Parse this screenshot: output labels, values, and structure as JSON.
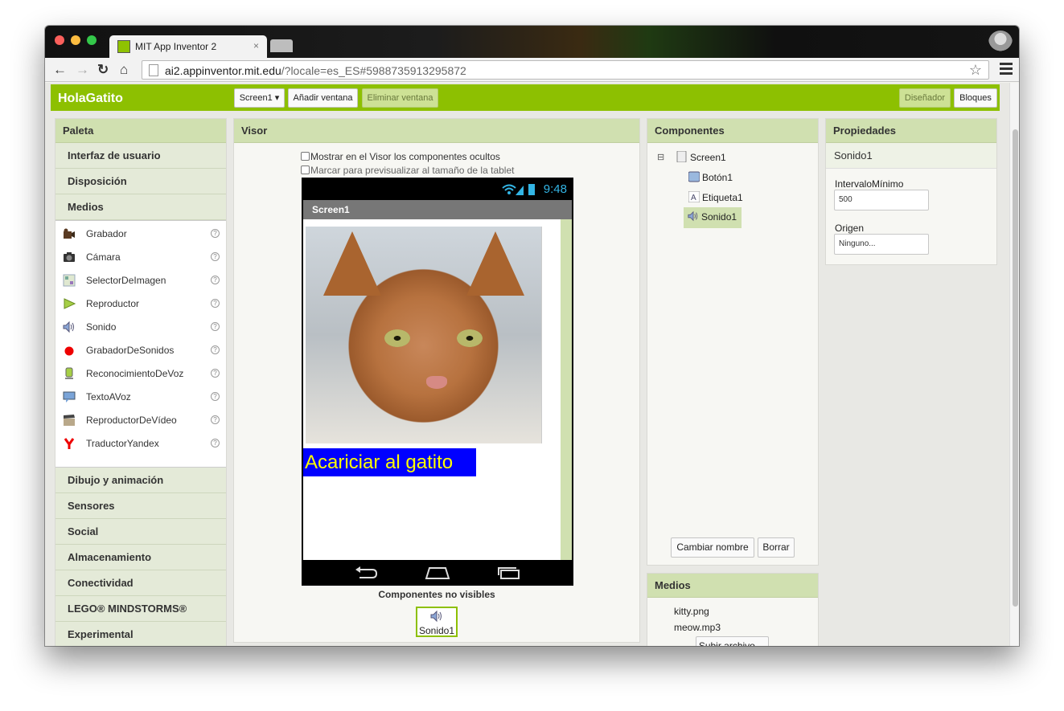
{
  "browser": {
    "tab_title": "MIT App Inventor 2",
    "tab_close": "×",
    "url_host": "ai2.appinventor.mit.edu",
    "url_path": "/?locale=es_ES#5988735913295872"
  },
  "appbar": {
    "project_name": "HolaGatito",
    "screen_select": "Screen1 ▾",
    "add_screen": "Añadir ventana",
    "remove_screen": "Eliminar ventana",
    "designer": "Diseñador",
    "blocks": "Bloques"
  },
  "palette": {
    "title": "Paleta",
    "categories_top": [
      "Interfaz de usuario",
      "Disposición",
      "Medios"
    ],
    "items": [
      {
        "label": "Grabador",
        "icon": "camcorder-icon"
      },
      {
        "label": "Cámara",
        "icon": "camera-icon"
      },
      {
        "label": "SelectorDeImagen",
        "icon": "image-picker-icon"
      },
      {
        "label": "Reproductor",
        "icon": "play-icon"
      },
      {
        "label": "Sonido",
        "icon": "speaker-icon"
      },
      {
        "label": "GrabadorDeSonidos",
        "icon": "record-icon"
      },
      {
        "label": "ReconocimientoDeVoz",
        "icon": "microphone-icon"
      },
      {
        "label": "TextoAVoz",
        "icon": "speech-bubble-icon"
      },
      {
        "label": "ReproductorDeVídeo",
        "icon": "clapperboard-icon"
      },
      {
        "label": "TraductorYandex",
        "icon": "yandex-icon"
      }
    ],
    "help_glyph": "?",
    "categories_bottom": [
      "Dibujo y animación",
      "Sensores",
      "Social",
      "Almacenamiento",
      "Conectividad",
      "LEGO® MINDSTORMS®",
      "Experimental"
    ]
  },
  "viewer": {
    "title": "Visor",
    "show_hidden": "Mostrar en el Visor los componentes ocultos",
    "tablet_preview": "Marcar para previsualizar al tamaño de la tablet",
    "time": "9:48",
    "screen_title": "Screen1",
    "button_text": "Acariciar al gatito",
    "nonvisible_title": "Componentes no visibles",
    "nonvisible_item": "Sonido1"
  },
  "components": {
    "title": "Componentes",
    "collapse_glyph": "⊟",
    "tree": [
      "Screen1",
      "Botón1",
      "Etiqueta1",
      "Sonido1"
    ],
    "selected": "Sonido1",
    "rename": "Cambiar nombre",
    "delete": "Borrar"
  },
  "media": {
    "title": "Medios",
    "files": [
      "kitty.png",
      "meow.mp3"
    ],
    "upload": "Subir archivo ..."
  },
  "properties": {
    "title": "Propiedades",
    "component": "Sonido1",
    "min_interval_label": "IntervaloMínimo",
    "min_interval_value": "500",
    "source_label": "Origen",
    "source_value": "Ninguno..."
  },
  "colors": {
    "accent": "#8dc001",
    "panel_header": "#d0e0b0",
    "android_blue": "#33b5e5",
    "button_bg": "#0000ff",
    "button_text": "#ffff00"
  }
}
